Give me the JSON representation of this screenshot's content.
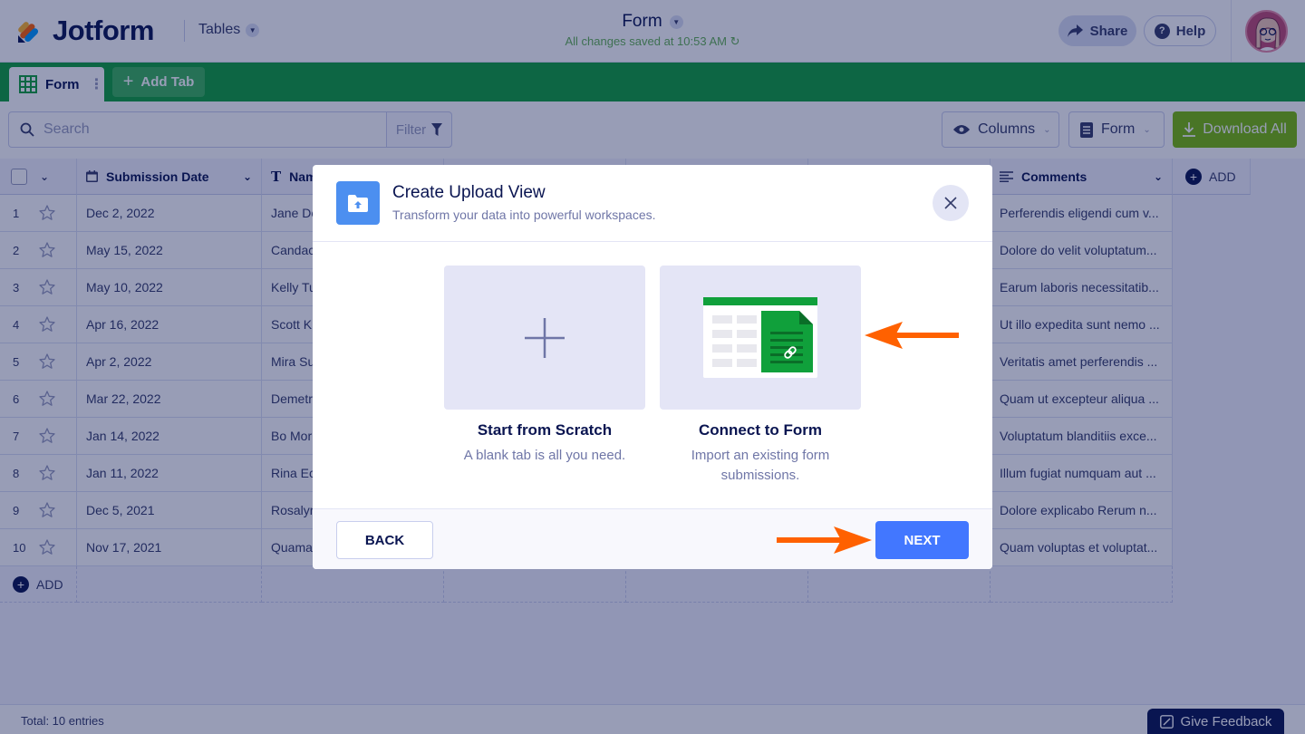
{
  "header": {
    "logo_text": "Jotform",
    "tables_label": "Tables",
    "form_title": "Form",
    "saved_status": "All changes saved at 10:53 AM",
    "share_label": "Share",
    "help_label": "Help"
  },
  "tabs": {
    "active_tab": "Form",
    "add_tab": "Add Tab"
  },
  "toolbar": {
    "search_placeholder": "Search",
    "filter_label": "Filter",
    "columns_label": "Columns",
    "form_label": "Form",
    "download_label": "Download All"
  },
  "table": {
    "headers": [
      "Submission Date",
      "Nam",
      "Comments",
      "ADD"
    ],
    "rows": [
      {
        "num": "1",
        "date": "Dec 2, 2022",
        "name": "Jane De",
        "comment": "Perferendis eligendi cum v..."
      },
      {
        "num": "2",
        "date": "May 15, 2022",
        "name": "Candac",
        "comment": "Dolore do velit voluptatum..."
      },
      {
        "num": "3",
        "date": "May 10, 2022",
        "name": "Kelly Tu",
        "comment": "Earum laboris necessitatib..."
      },
      {
        "num": "4",
        "date": "Apr 16, 2022",
        "name": "Scott K",
        "comment": "Ut illo expedita sunt nemo ..."
      },
      {
        "num": "5",
        "date": "Apr 2, 2022",
        "name": "Mira Su",
        "comment": "Veritatis amet perferendis ..."
      },
      {
        "num": "6",
        "date": "Mar 22, 2022",
        "name": "Demetr",
        "comment": "Quam ut excepteur aliqua ..."
      },
      {
        "num": "7",
        "date": "Jan 14, 2022",
        "name": "Bo Mor",
        "comment": "Voluptatum blanditiis exce..."
      },
      {
        "num": "8",
        "date": "Jan 11, 2022",
        "name": "Rina Ec",
        "comment": "Illum fugiat numquam aut ..."
      },
      {
        "num": "9",
        "date": "Dec 5, 2021",
        "name": "Rosalyr",
        "comment": "Dolore explicabo Rerum n..."
      },
      {
        "num": "10",
        "date": "Nov 17, 2021",
        "name": "Quama",
        "comment": "Quam voluptas et voluptat..."
      }
    ],
    "add_row_label": "ADD"
  },
  "footer": {
    "total": "Total: 10 entries",
    "feedback": "Give Feedback"
  },
  "modal": {
    "title": "Create Upload View",
    "subtitle": "Transform your data into powerful workspaces.",
    "option1_title": "Start from Scratch",
    "option1_desc": "A blank tab is all you need.",
    "option2_title": "Connect to Form",
    "option2_desc": "Import an existing form submissions.",
    "back_label": "BACK",
    "next_label": "NEXT"
  },
  "colors": {
    "brand_green": "#10a03b",
    "download_green": "#78bb07",
    "next_blue": "#4277ff",
    "annotation_orange": "#ff6100"
  }
}
